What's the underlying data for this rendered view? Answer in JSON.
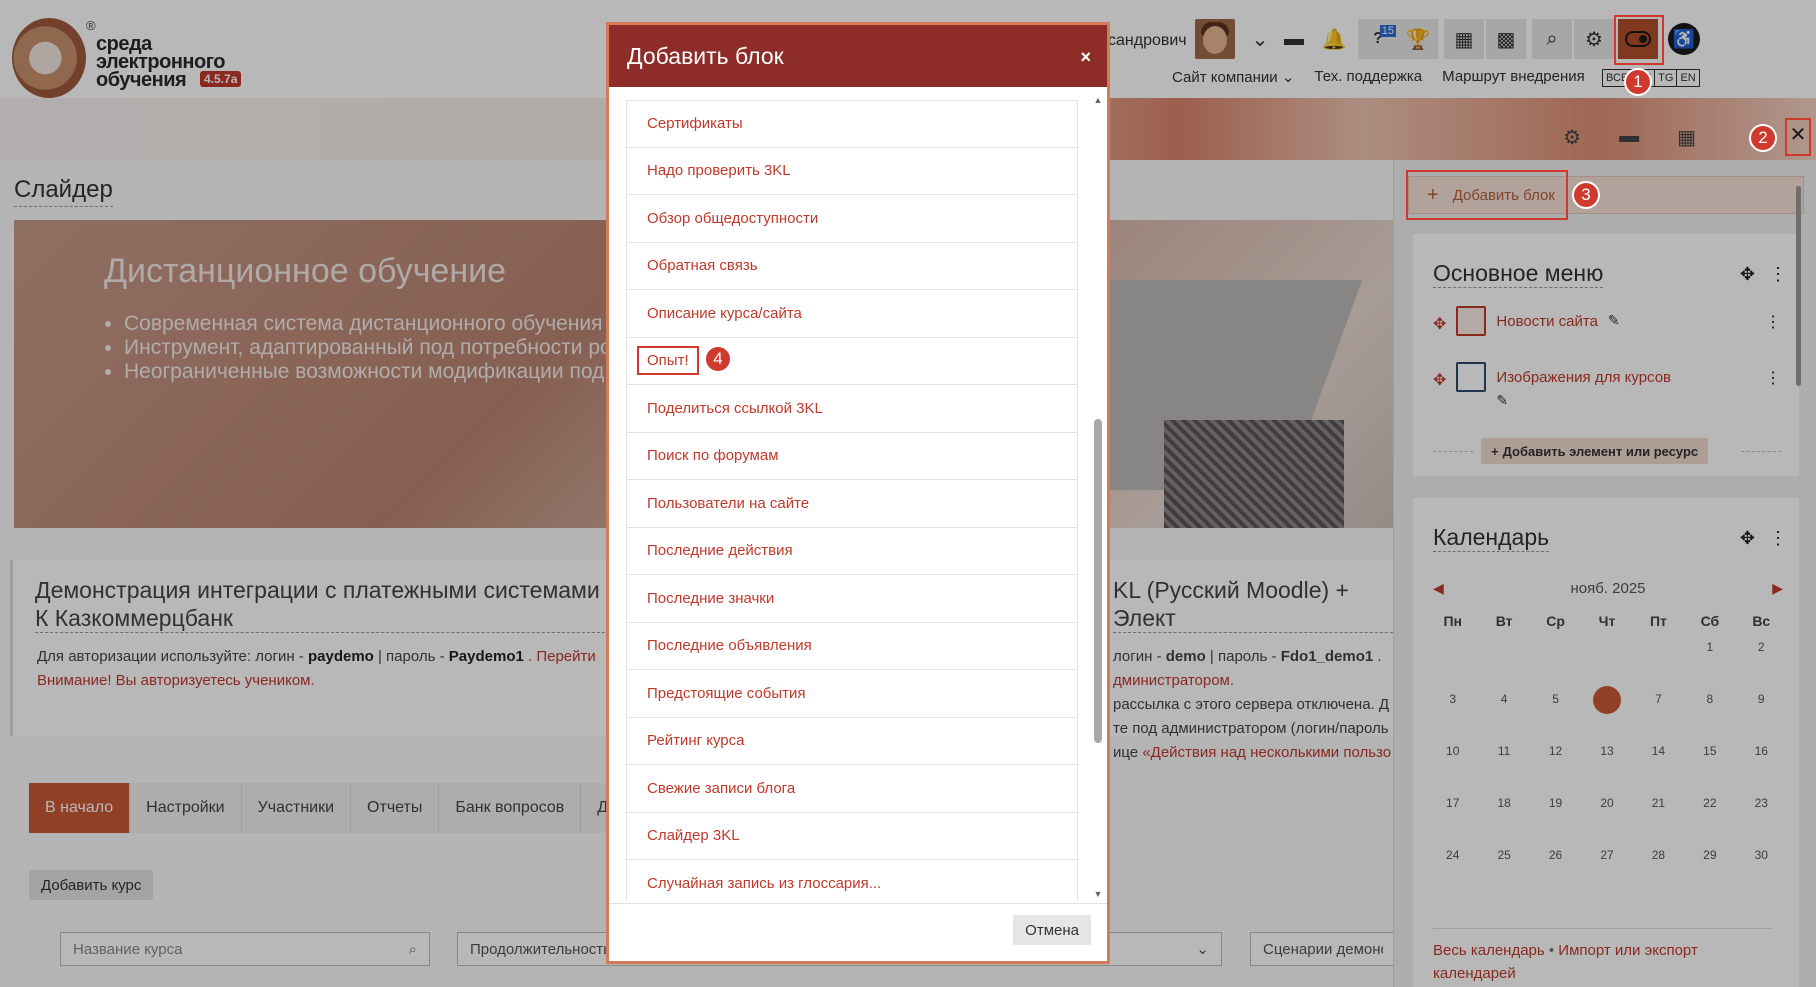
{
  "header": {
    "logo": {
      "line1": "среда",
      "line2": "электронного",
      "line3": "обучения",
      "version": "4.5.7a",
      "reg": "®"
    },
    "user_name": "сандрович",
    "messages_badge": "15",
    "nav": [
      "Сайт компании ⌄",
      "Тех. поддержка",
      "Маршрут внедрения"
    ],
    "languages": [
      "ВСЕ",
      "RU",
      "TG",
      "EN"
    ]
  },
  "page": {
    "title": "Слайдер",
    "slider": {
      "title": "Дистанционное обучение",
      "bullets": [
        "Современная система дистанционного обучения и",
        "Инструмент, адаптированный под потребности ро",
        "Неограниченные возможности модификации под"
      ]
    },
    "course_left": {
      "title": "Демонстрация интеграции с платежными системами К Казкоммерцбанк",
      "note_prefix": "Для авторизации используйте: логин - ",
      "login": "paydemo",
      "note_mid": " | пароль - ",
      "password": "Paydemo1",
      "note_link": " . Перейти",
      "warning": "Внимание! Вы авторизуетесь учеником."
    },
    "course_right": {
      "title": "KL (Русский Moodle) + Элект",
      "line1_prefix": "логин - ",
      "login": "demo",
      "line1_mid": " | пароль - ",
      "password": "Fdo1_demo1",
      "line1_end": " .",
      "line2": "дминистратором.",
      "line3": " рассылка с этого сервера отключена. Д",
      "line4": "те под администратором (логин/пароль",
      "line5_prefix": "ице ",
      "line5_link": "«Действия над несколькими пользо"
    },
    "tabs": [
      "В начало",
      "Настройки",
      "Участники",
      "Отчеты",
      "Банк вопросов",
      "Доп"
    ],
    "add_course": "Добавить курс",
    "filters": {
      "name_placeholder": "Название курса",
      "duration": "Продолжительность",
      "scenario": "Сценарии демонст"
    }
  },
  "drawer": {
    "add_block": "Добавить блок",
    "main_menu": {
      "title": "Основное меню",
      "items": [
        "Новости сайта",
        "Изображения для курсов"
      ],
      "add_resource": "Добавить элемент или ресурс"
    },
    "calendar": {
      "title": "Календарь",
      "month": "нояб. 2025",
      "weekdays": [
        "Пн",
        "Вт",
        "Ср",
        "Чт",
        "Пт",
        "Сб",
        "Вс"
      ],
      "weeks": [
        [
          "",
          "",
          "",
          "",
          "",
          "1",
          "2"
        ],
        [
          "3",
          "4",
          "5",
          "6",
          "7",
          "8",
          "9"
        ],
        [
          "10",
          "11",
          "12",
          "13",
          "14",
          "15",
          "16"
        ],
        [
          "17",
          "18",
          "19",
          "20",
          "21",
          "22",
          "23"
        ],
        [
          "24",
          "25",
          "26",
          "27",
          "28",
          "29",
          "30"
        ]
      ],
      "today": "6",
      "footer_link1": "Весь календарь",
      "footer_sep": " • ",
      "footer_link2": "Импорт или экспорт календарей"
    }
  },
  "modal": {
    "title": "Добавить блок",
    "close": "×",
    "items": [
      "Сертификаты",
      "Надо проверить 3KL",
      "Обзор общедоступности",
      "Обратная связь",
      "Описание курса/сайта",
      "Опыт!",
      "Поделиться ссылкой 3KL",
      "Поиск по форумам",
      "Пользователи на сайте",
      "Последние действия",
      "Последние значки",
      "Последние объявления",
      "Предстоящие события",
      "Рейтинг курса",
      "Свежие записи блога",
      "Слайдер 3KL",
      "Случайная запись из глоссария..."
    ],
    "cancel": "Отмена"
  },
  "annotations": {
    "n1": "1",
    "n2": "2",
    "n3": "3",
    "n4": "4"
  },
  "colors": {
    "accent": "#c85a34",
    "modal_header": "#8e2c28",
    "link": "#c0392b",
    "highlight": "#d03a2e"
  }
}
